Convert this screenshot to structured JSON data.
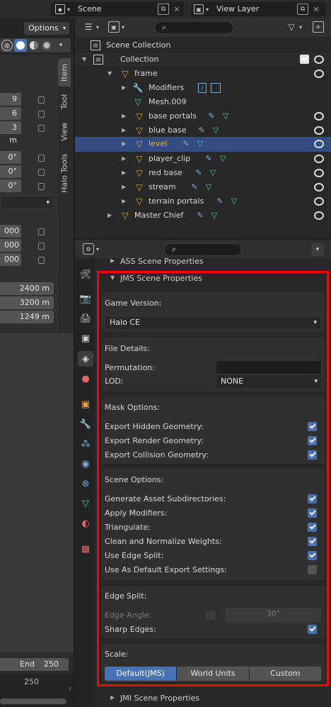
{
  "top_bar": {
    "scene": "Scene",
    "view_layer": "View Layer"
  },
  "viewport": {
    "options_label": "Options",
    "tabs": [
      "Item",
      "Tool",
      "View",
      "Halo Tools"
    ],
    "loc_values": [
      "9 m",
      "6 m",
      "3 m"
    ],
    "rot_values": [
      "0°",
      "0°",
      "0°"
    ],
    "scale_values": [
      "000",
      "000",
      "000"
    ],
    "dim_values": [
      "2400 m",
      "3200 m",
      "1249 m"
    ],
    "end_label": "End",
    "end_value": "250",
    "frame_value": "250"
  },
  "outliner": {
    "scene_collection": "Scene Collection",
    "items": [
      {
        "label": "Collection"
      },
      {
        "label": "frame"
      },
      {
        "label": "Modifiers"
      },
      {
        "label": "Mesh.009"
      },
      {
        "label": "base portals"
      },
      {
        "label": "blue base"
      },
      {
        "label": "level"
      },
      {
        "label": "player_clip"
      },
      {
        "label": "red base"
      },
      {
        "label": "stream"
      },
      {
        "label": "terrain portals"
      },
      {
        "label": "Master Chief"
      }
    ]
  },
  "properties": {
    "ass_header": "ASS Scene Properties",
    "jms_header": "JMS Scene Properties",
    "game_version_label": "Game Version:",
    "game_version_value": "Halo CE",
    "file_details_label": "File Details:",
    "permutation_label": "Permutation:",
    "permutation_value": "",
    "lod_label": "LOD:",
    "lod_value": "NONE",
    "mask_label": "Mask Options:",
    "mask_options": [
      {
        "label": "Export Hidden Geometry:",
        "checked": true
      },
      {
        "label": "Export Render Geometry:",
        "checked": true
      },
      {
        "label": "Export Collision Geometry:",
        "checked": true
      }
    ],
    "scene_label": "Scene Options:",
    "scene_options": [
      {
        "label": "Generate Asset Subdirectories:",
        "checked": true
      },
      {
        "label": "Apply Modifiers:",
        "checked": true
      },
      {
        "label": "Triangulate:",
        "checked": true
      },
      {
        "label": "Clean and Normalize Weights:",
        "checked": true
      },
      {
        "label": "Use Edge Split:",
        "checked": true
      },
      {
        "label": "Use As Default Export Settings:",
        "checked": false
      }
    ],
    "edge_split_label": "Edge Split:",
    "edge_angle_label": "Edge Angle:",
    "edge_angle_value": "30°",
    "sharp_edges_label": "Sharp Edges:",
    "scale_label": "Scale:",
    "scale_options": [
      "Default(JMS)",
      "World Units",
      "Custom"
    ],
    "jmi_header": "JMI Scene Properties"
  },
  "colors": {
    "highlight": "#334d80",
    "accent": "#4772b3",
    "orange": "#e8a23b",
    "teal": "#3fd1a4",
    "red_outline": "#ff0000"
  }
}
